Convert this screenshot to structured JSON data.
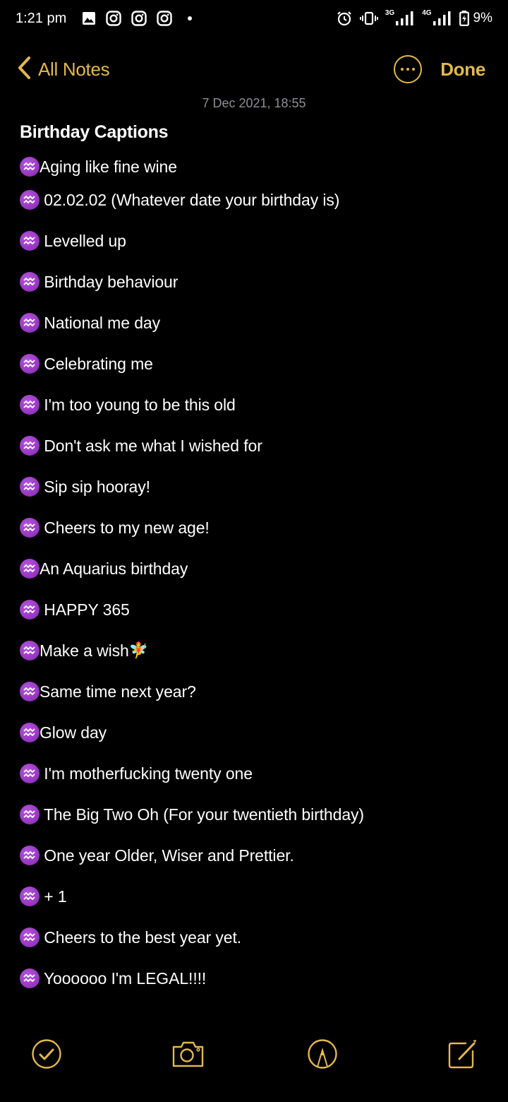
{
  "status_bar": {
    "time": "1:21 pm",
    "left_icons": [
      "gallery-icon",
      "instagram-icon",
      "instagram-icon",
      "instagram-icon",
      "notification-dot-icon"
    ],
    "right_icons": [
      "alarm-icon",
      "vibrate-icon",
      "signal-3g-icon",
      "signal-4g-icon",
      "battery-charging-icon"
    ],
    "network_1": "3G",
    "network_2": "4G",
    "battery": "9%"
  },
  "nav": {
    "back_label": "All Notes",
    "done_label": "Done",
    "accent_color": "#e2b84f"
  },
  "note": {
    "date": "7 Dec 2021, 18:55",
    "title": "Birthday Captions",
    "bullet_emoji": "aquarius-icon",
    "lines": [
      "Aging like fine wine",
      " 02.02.02 (Whatever date your birthday is)",
      " Levelled up",
      " Birthday behaviour",
      " National me day",
      " Celebrating me",
      " I'm too young to be this old",
      " Don't ask me what I wished for",
      " Sip sip hooray!",
      " Cheers to my new age!",
      "An Aquarius birthday",
      " HAPPY 365",
      "Make a wish",
      "Same time next year?",
      "Glow day",
      " I'm motherfucking twenty one",
      " The Big Two Oh (For your twentieth birthday)",
      " One year Older, Wiser and Prettier.",
      " + 1",
      " Cheers to the best year yet.",
      " Yoooooo I'm LEGAL!!!!"
    ],
    "fairy_emoji": "🧚"
  },
  "toolbar": {
    "items": [
      "checklist-icon",
      "camera-icon",
      "markup-icon",
      "compose-icon"
    ]
  }
}
